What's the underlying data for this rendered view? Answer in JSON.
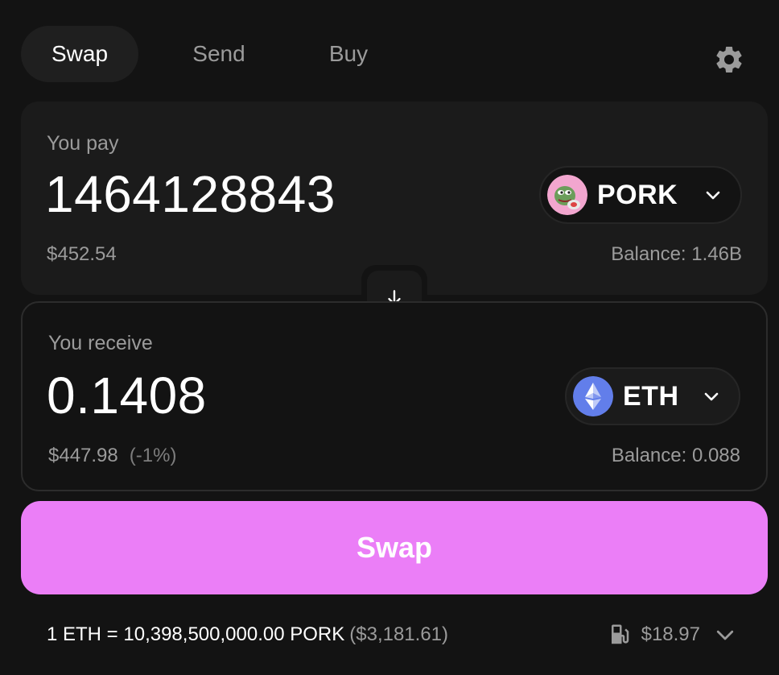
{
  "tabs": [
    {
      "label": "Swap",
      "active": true
    },
    {
      "label": "Send",
      "active": false
    },
    {
      "label": "Buy",
      "active": false
    }
  ],
  "pay": {
    "label": "You pay",
    "amount": "1464128843",
    "usd": "$452.54",
    "token": "PORK",
    "balance": "Balance: 1.46B"
  },
  "receive": {
    "label": "You receive",
    "amount": "0.1408",
    "usd": "$447.98",
    "impact": "(-1%)",
    "token": "ETH",
    "balance": "Balance: 0.088"
  },
  "swap_button": "Swap",
  "footer": {
    "rate": "1 ETH = 10,398,500,000.00 PORK",
    "rate_usd": "($3,181.61)",
    "gas": "$18.97"
  },
  "colors": {
    "background": "#131313",
    "panel": "#1b1b1b",
    "accent": "#eb7ef7",
    "muted": "#9b9b9b",
    "eth": "#627eea",
    "pork": "#f2a6cf"
  },
  "icons": {
    "settings": "gear-icon",
    "switch": "arrow-down-icon",
    "token_select": "chevron-down-icon",
    "gas": "gas-pump-icon",
    "expand": "chevron-down-icon"
  }
}
